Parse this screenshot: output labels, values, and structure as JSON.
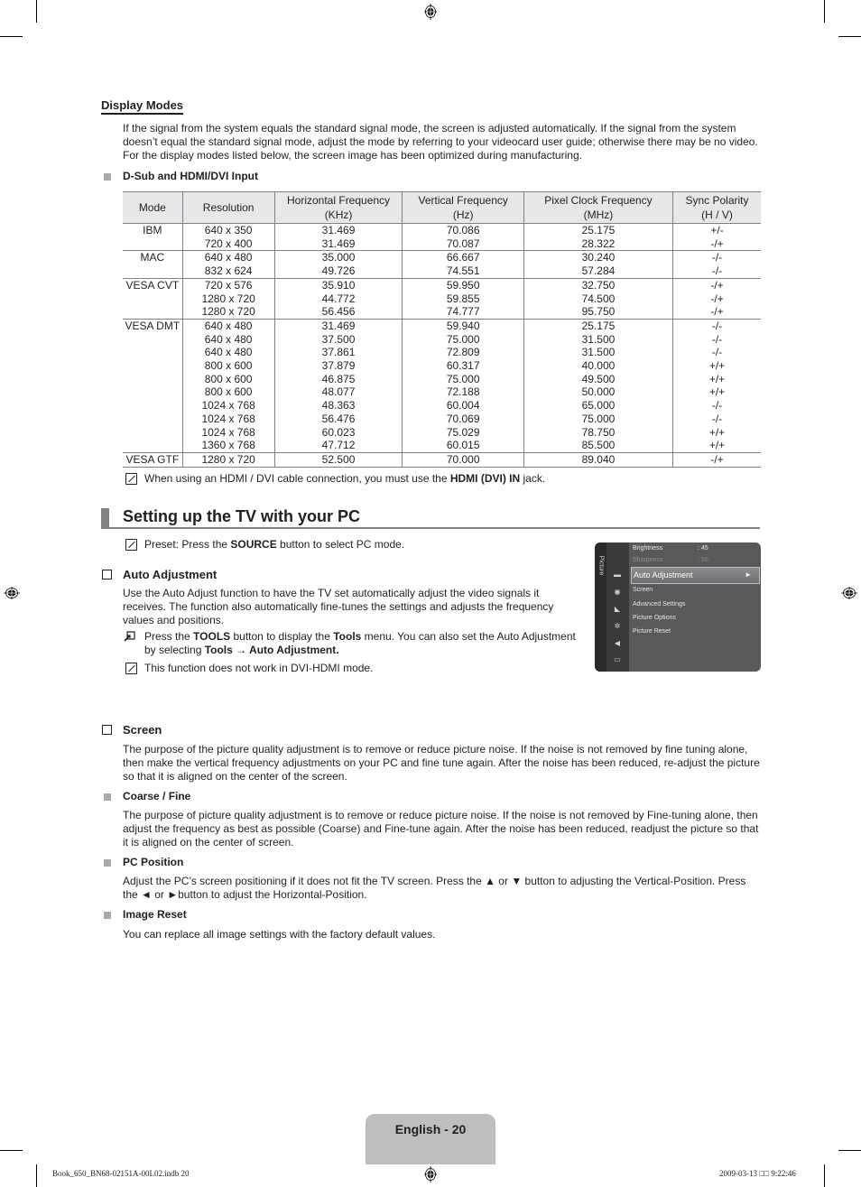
{
  "display_modes": {
    "title": "Display Modes",
    "intro": "If the signal from the system equals the standard signal mode, the screen is adjusted automatically. If the signal from the system doesn’t equal the standard signal mode, adjust the mode by referring to your videocard user guide; otherwise there may be no video. For the display modes listed below, the screen image has been optimized during manufacturing.",
    "input_heading": "D-Sub and HDMI/DVI Input",
    "table": {
      "headers": [
        [
          "Mode"
        ],
        [
          "Resolution"
        ],
        [
          "Horizontal Frequency",
          "(KHz)"
        ],
        [
          "Vertical Frequency",
          "(Hz)"
        ],
        [
          "Pixel Clock Frequency",
          "(MHz)"
        ],
        [
          "Sync Polarity",
          "(H / V)"
        ]
      ],
      "groups": [
        {
          "mode": "IBM",
          "rows": [
            [
              "640 x 350",
              "31.469",
              "70.086",
              "25.175",
              "+/-"
            ],
            [
              "720 x 400",
              "31.469",
              "70.087",
              "28.322",
              "-/+"
            ]
          ]
        },
        {
          "mode": "MAC",
          "rows": [
            [
              "640 x 480",
              "35.000",
              "66.667",
              "30.240",
              "-/-"
            ],
            [
              "832 x 624",
              "49.726",
              "74.551",
              "57.284",
              "-/-"
            ]
          ]
        },
        {
          "mode": "VESA CVT",
          "rows": [
            [
              "720 x 576",
              "35.910",
              "59.950",
              "32.750",
              "-/+"
            ],
            [
              "1280 x 720",
              "44.772",
              "59.855",
              "74.500",
              "-/+"
            ],
            [
              "1280 x 720",
              "56.456",
              "74.777",
              "95.750",
              "-/+"
            ]
          ]
        },
        {
          "mode": "VESA DMT",
          "rows": [
            [
              "640 x 480",
              "31.469",
              "59.940",
              "25.175",
              "-/-"
            ],
            [
              "640 x 480",
              "37.500",
              "75.000",
              "31.500",
              "-/-"
            ],
            [
              "640 x 480",
              "37.861",
              "72.809",
              "31.500",
              "-/-"
            ],
            [
              "800 x 600",
              "37.879",
              "60.317",
              "40.000",
              "+/+"
            ],
            [
              "800 x 600",
              "46.875",
              "75.000",
              "49.500",
              "+/+"
            ],
            [
              "800 x 600",
              "48.077",
              "72.188",
              "50.000",
              "+/+"
            ],
            [
              "1024 x 768",
              "48.363",
              "60.004",
              "65.000",
              "-/-"
            ],
            [
              "1024 x 768",
              "56.476",
              "70.069",
              "75.000",
              "-/-"
            ],
            [
              "1024 x 768",
              "60.023",
              "75.029",
              "78.750",
              "+/+"
            ],
            [
              "1360 x 768",
              "47.712",
              "60.015",
              "85.500",
              "+/+"
            ]
          ]
        },
        {
          "mode": "VESA GTF",
          "rows": [
            [
              "1280 x 720",
              "52.500",
              "70.000",
              "89.040",
              "-/+"
            ]
          ]
        }
      ]
    },
    "note_prefix": "When using an HDMI / DVI cable connection, you must use the ",
    "note_bold": "HDMI (DVI) IN",
    "note_suffix": " jack."
  },
  "pc_setup": {
    "title": "Setting up the TV with your PC",
    "preset_prefix": "Preset: Press the ",
    "preset_bold": "SOURCE",
    "preset_suffix": " button to select PC mode.",
    "auto_adjustment": {
      "title": "Auto Adjustment",
      "body": "Use the Auto Adjust function to have the TV set automatically adjust the video signals it receives. The function also automatically fine-tunes the settings and adjusts the frequency values and positions.",
      "tools_1": "Press the ",
      "tools_2": "TOOLS",
      "tools_3": " button to display the ",
      "tools_4": "Tools",
      "tools_5": " menu. You can also set the Auto Adjustment by selecting ",
      "tools_6": "Tools → Auto Adjustment.",
      "note": "This function does not work in DVI-HDMI mode."
    },
    "osd": {
      "tab_label": "Picture",
      "items": [
        {
          "label": "Brightness",
          "value": ": 45"
        },
        {
          "label": "Sharpness",
          "value": ": 50"
        }
      ],
      "selected": "Auto Adjustment",
      "selected_arrow": "►",
      "menu": [
        "Screen",
        "Advanced Settings",
        "Picture Options",
        "Picture Reset"
      ]
    },
    "screen": {
      "title": "Screen",
      "body": "The purpose of the picture quality adjustment is to remove or reduce picture noise. If the noise is not removed by fine tuning alone, then make the vertical frequency adjustments on your PC and fine tune again. After the noise has been reduced, re-adjust the picture so that it is aligned on the center of the screen."
    },
    "coarse_fine": {
      "title": "Coarse / Fine",
      "body": "The purpose of picture quality adjustment is to remove or reduce picture noise. If the noise is not removed by Fine-tuning alone, then adjust the frequency as best as possible (Coarse) and Fine-tune again. After the noise has been reduced, readjust the picture so that it is aligned on the center of screen."
    },
    "pc_position": {
      "title": "PC Position",
      "body": "Adjust the PC’s screen positioning if it does not fit the TV screen. Press the ▲ or ▼ button to adjusting the Vertical-Position. Press the ◄ or ►button to adjust the Horizontal-Position."
    },
    "image_reset": {
      "title": "Image Reset",
      "body": "You can replace all image settings with the factory default values."
    }
  },
  "footer": {
    "page_label": "English - 20",
    "slug_left": "Book_650_BN68-02151A-00L02.indb   20",
    "slug_right": "2009-03-13   □□ 9:22:46"
  }
}
